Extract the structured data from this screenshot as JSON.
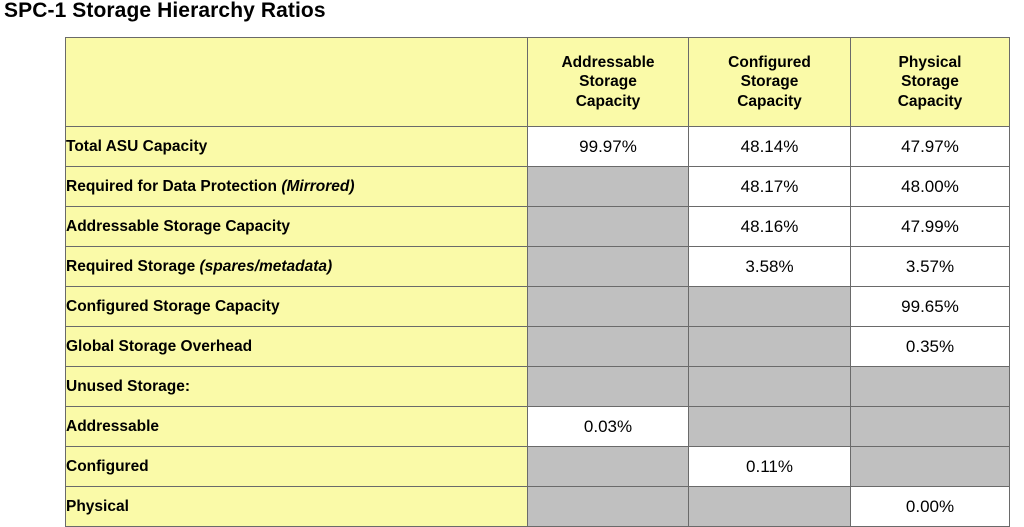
{
  "page": {
    "title": "SPC-1 Storage Hierarchy Ratios"
  },
  "colors": {
    "header_yellow": "#fafaa8",
    "label_yellow": "#fafaa8",
    "disabled_gray": "#c0c0c0",
    "value_white": "#ffffff",
    "border": "#6a6a6a",
    "text": "#000000"
  },
  "table": {
    "corner_label": "",
    "columns": [
      {
        "id": "addressable",
        "label": "Addressable\nStorage\nCapacity",
        "lines": [
          "Addressable",
          "Storage",
          "Capacity"
        ]
      },
      {
        "id": "configured",
        "label": "Configured\nStorage\nCapacity",
        "lines": [
          "Configured",
          "Storage",
          "Capacity"
        ]
      },
      {
        "id": "physical",
        "label": "Physical\nStorage\nCapacity",
        "lines": [
          "Physical",
          "Storage",
          "Capacity"
        ]
      }
    ],
    "rows": [
      {
        "label": "Total ASU Capacity",
        "label_plain": "Total ASU Capacity",
        "label_italic": "",
        "indent": false,
        "cells": [
          {
            "value": "99.97%",
            "filled": true
          },
          {
            "value": "48.14%",
            "filled": true
          },
          {
            "value": "47.97%",
            "filled": true
          }
        ]
      },
      {
        "label": "Required for Data Protection (Mirrored)",
        "label_plain": "Required for Data Protection ",
        "label_italic": "(Mirrored)",
        "indent": false,
        "cells": [
          {
            "value": "",
            "filled": false
          },
          {
            "value": "48.17%",
            "filled": true
          },
          {
            "value": "48.00%",
            "filled": true
          }
        ]
      },
      {
        "label": "Addressable Storage Capacity",
        "label_plain": "Addressable Storage Capacity",
        "label_italic": "",
        "indent": false,
        "cells": [
          {
            "value": "",
            "filled": false
          },
          {
            "value": "48.16%",
            "filled": true
          },
          {
            "value": "47.99%",
            "filled": true
          }
        ]
      },
      {
        "label": "Required Storage (spares/metadata)",
        "label_plain": "Required Storage ",
        "label_italic": "(spares/metadata)",
        "indent": false,
        "cells": [
          {
            "value": "",
            "filled": false
          },
          {
            "value": "3.58%",
            "filled": true
          },
          {
            "value": "3.57%",
            "filled": true
          }
        ]
      },
      {
        "label": "Configured Storage Capacity",
        "label_plain": "Configured Storage Capacity",
        "label_italic": "",
        "indent": false,
        "cells": [
          {
            "value": "",
            "filled": false
          },
          {
            "value": "",
            "filled": false
          },
          {
            "value": "99.65%",
            "filled": true
          }
        ]
      },
      {
        "label": "Global Storage Overhead",
        "label_plain": "Global Storage Overhead",
        "label_italic": "",
        "indent": false,
        "cells": [
          {
            "value": "",
            "filled": false
          },
          {
            "value": "",
            "filled": false
          },
          {
            "value": "0.35%",
            "filled": true
          }
        ]
      },
      {
        "label": "Unused Storage:",
        "label_plain": "Unused Storage:",
        "label_italic": "",
        "indent": false,
        "cells": [
          {
            "value": "",
            "filled": false
          },
          {
            "value": "",
            "filled": false
          },
          {
            "value": "",
            "filled": false
          }
        ]
      },
      {
        "label": "Addressable",
        "label_plain": "Addressable",
        "label_italic": "",
        "indent": true,
        "cells": [
          {
            "value": "0.03%",
            "filled": true
          },
          {
            "value": "",
            "filled": false
          },
          {
            "value": "",
            "filled": false
          }
        ]
      },
      {
        "label": "Configured",
        "label_plain": "Configured",
        "label_italic": "",
        "indent": true,
        "cells": [
          {
            "value": "",
            "filled": false
          },
          {
            "value": "0.11%",
            "filled": true
          },
          {
            "value": "",
            "filled": false
          }
        ]
      },
      {
        "label": "Physical",
        "label_plain": "Physical",
        "label_italic": "",
        "indent": true,
        "cells": [
          {
            "value": "",
            "filled": false
          },
          {
            "value": "",
            "filled": false
          },
          {
            "value": "0.00%",
            "filled": true
          }
        ]
      }
    ]
  }
}
